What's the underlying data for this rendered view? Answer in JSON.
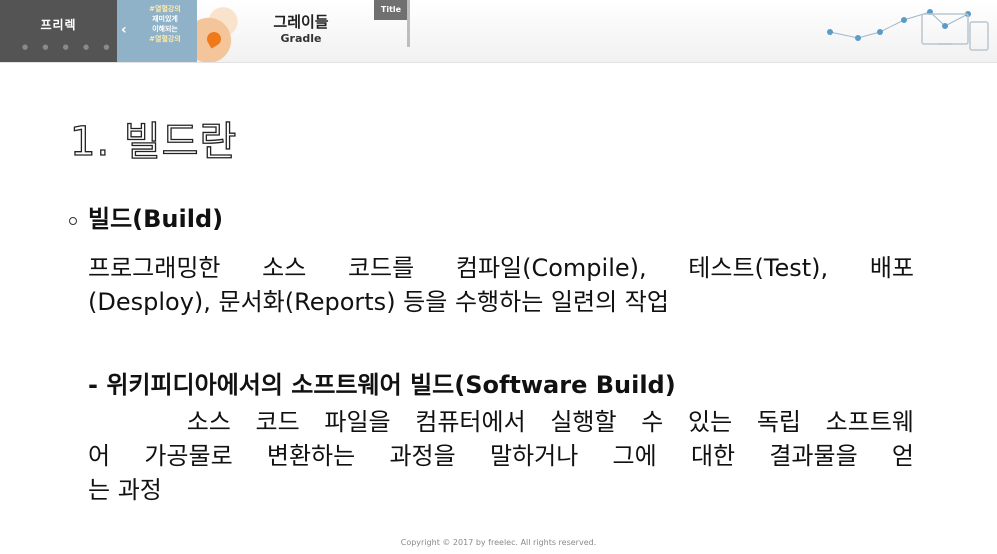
{
  "header": {
    "brand_name": "프리렉",
    "brand_dots": "● ● ● ● ●",
    "promo_arrow": "‹",
    "promo_lines": [
      "#열혈강의",
      "재미있게",
      "이해되는",
      "#열혈강의"
    ],
    "course_title": "그레이들",
    "course_subtitle": "Gradle",
    "title_tab": "Title",
    "colors": {
      "brand_box": "#545454",
      "promo_box": "#8fb2c8",
      "accent_orange": "#f07a1a",
      "network_blue": "#5b9bc7"
    }
  },
  "content": {
    "title": "1. 빌드란",
    "bullet_heading": "빌드(Build)",
    "description_lines": [
      "프로그래밍한 소스 코드를 컴파일(Compile), 테스트(Test), 배포",
      "(Desploy), 문서화(Reports) 등을 수행하는 일련의 작업"
    ],
    "wiki_heading": "- 위키피디아에서의 소프트웨어 빌드(Software Build)",
    "wiki_lines": [
      "    소스 코드 파일을 컴퓨터에서 실행할 수 있는 독립 소프트웨",
      "어 가공물로 변환하는 과정을 말하거나 그에 대한 결과물을 얻",
      "는 과정"
    ]
  },
  "footer": {
    "copyright": "Copyright © 2017 by freelec. All rights reserved."
  }
}
